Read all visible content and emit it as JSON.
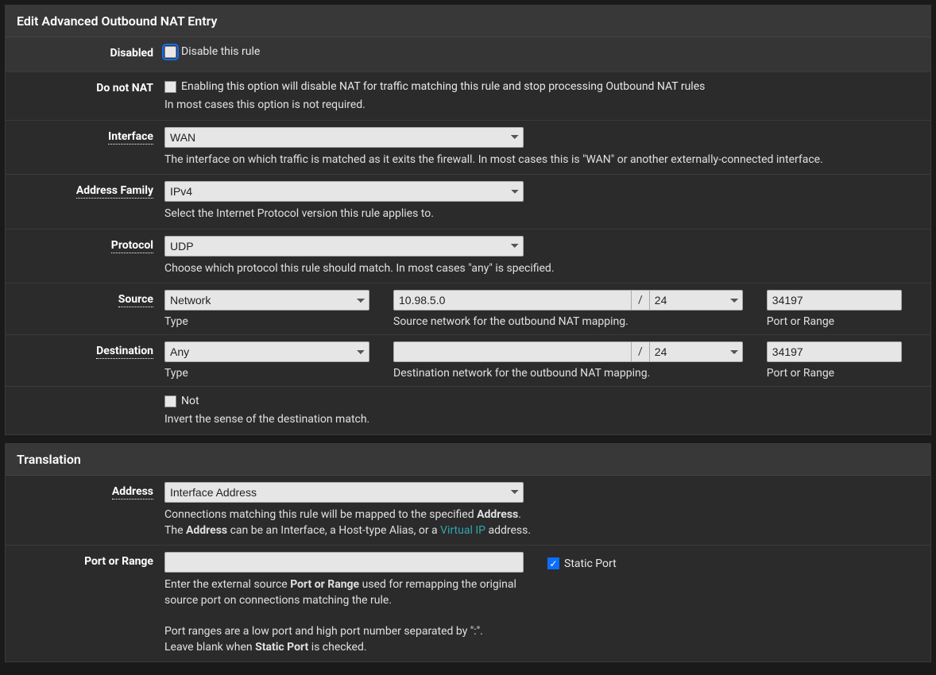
{
  "panel1": {
    "title": "Edit Advanced Outbound NAT Entry",
    "disabled": {
      "label": "Disabled",
      "text": "Disable this rule"
    },
    "donotnat": {
      "label": "Do not NAT",
      "text": "Enabling this option will disable NAT for traffic matching this rule and stop processing Outbound NAT rules",
      "help": "In most cases this option is not required."
    },
    "interface": {
      "label": "Interface",
      "value": "WAN",
      "help": "The interface on which traffic is matched as it exits the firewall. In most cases this is \"WAN\" or another externally-connected interface."
    },
    "addrfamily": {
      "label": "Address Family",
      "value": "IPv4",
      "help": "Select the Internet Protocol version this rule applies to."
    },
    "protocol": {
      "label": "Protocol",
      "value": "UDP",
      "help": "Choose which protocol this rule should match. In most cases \"any\" is specified."
    },
    "source": {
      "label": "Source",
      "type": "Network",
      "type_sub": "Type",
      "net": "10.98.5.0",
      "mask": "24",
      "net_sub": "Source network for the outbound NAT mapping.",
      "port": "34197",
      "port_sub": "Port or Range"
    },
    "dest": {
      "label": "Destination",
      "type": "Any",
      "type_sub": "Type",
      "net": "",
      "mask": "24",
      "net_sub": "Destination network for the outbound NAT mapping.",
      "port": "34197",
      "port_sub": "Port or Range"
    },
    "not": {
      "text": "Not",
      "help": "Invert the sense of the destination match."
    }
  },
  "panel2": {
    "title": "Translation",
    "address": {
      "label": "Address",
      "value": "Interface Address",
      "help1a": "Connections matching this rule will be mapped to the specified ",
      "help1b": "Address",
      "help1c": ".",
      "help2a": "The ",
      "help2b": "Address",
      "help2c": " can be an Interface, a Host-type Alias, or a ",
      "help2link": "Virtual IP",
      "help2d": " address."
    },
    "port": {
      "label": "Port or Range",
      "value": "",
      "static": "Static Port",
      "help1a": "Enter the external source ",
      "help1b": "Port or Range",
      "help1c": " used for remapping the original source port on connections matching the rule.",
      "help2": "Port ranges are a low port and high port number separated by \":\".",
      "help3a": "Leave blank when ",
      "help3b": "Static Port",
      "help3c": " is checked."
    }
  }
}
